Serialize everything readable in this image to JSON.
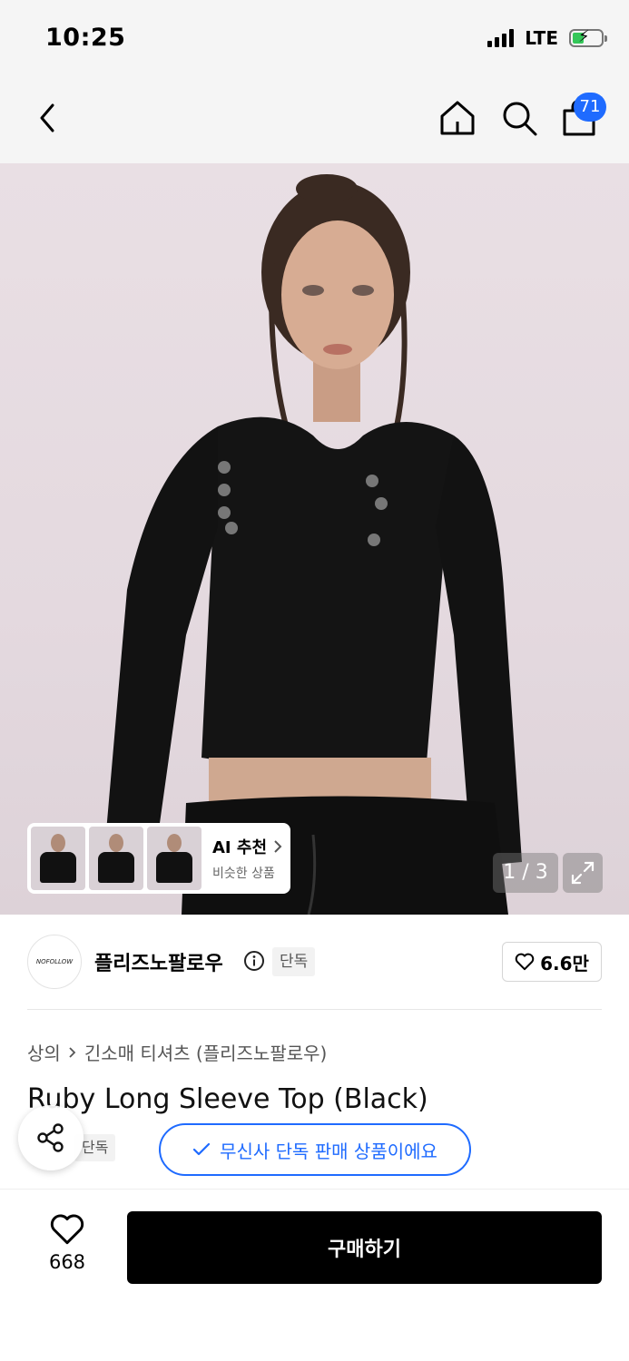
{
  "status_bar": {
    "time": "10:25",
    "network": "LTE"
  },
  "nav": {
    "cart_count": "71"
  },
  "hero": {
    "ai_card": {
      "title": "AI 추천",
      "subtitle": "비슷한 상품"
    },
    "counter": "1 / 3"
  },
  "brand": {
    "logo_text": "NOFOLLOW",
    "name": "플리즈노팔로우",
    "tag": "단독",
    "like_count": "6.6만"
  },
  "breadcrumb": {
    "category": "상의",
    "subcategory": "긴소매 티셔츠 (플리즈노팔로우)"
  },
  "product": {
    "title": "Ruby Long Sleeve Top (Black)",
    "tag": "단독",
    "exclusive_label": "무신사 단독 판매 상품이에요"
  },
  "bottom_bar": {
    "like_count": "668",
    "buy_label": "구매하기"
  },
  "colors": {
    "accent": "#1f6bff",
    "buy_button": "#000000",
    "battery": "#34c759"
  },
  "icons": [
    "back-icon",
    "home-icon",
    "search-icon",
    "shopping-bag-icon",
    "info-icon",
    "heart-icon",
    "share-icon",
    "check-icon",
    "expand-icon",
    "chevron-right-icon"
  ]
}
